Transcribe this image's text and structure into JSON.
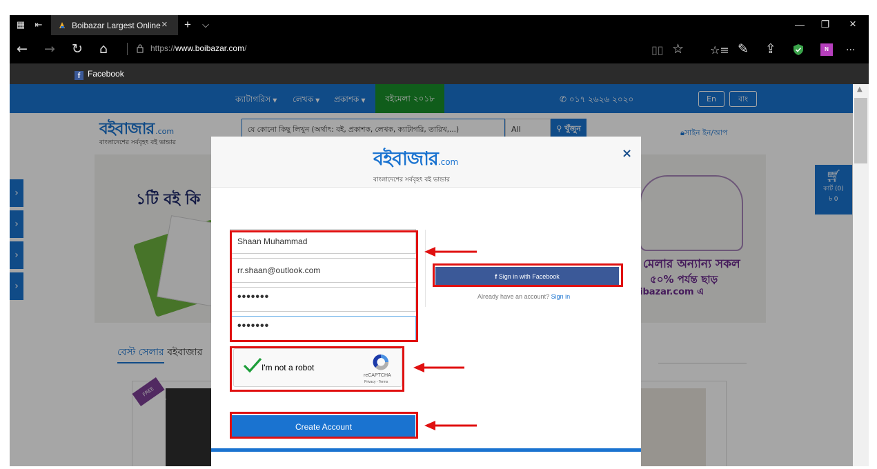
{
  "browser": {
    "tab_title": "Boibazar Largest Online",
    "tab_close": "×",
    "new_tab": "+",
    "tab_list": "⌵",
    "url_host": "https://",
    "url_domain": "www.boibazar.com",
    "url_path": "/",
    "favorites": [
      {
        "label": "Facebook"
      }
    ],
    "window_minimize": "—",
    "window_restore": "❐",
    "window_close": "×",
    "more": "···"
  },
  "site": {
    "menu": {
      "categories": "ক্যাটাগরিস",
      "authors": "লেখক",
      "publishers": "প্রকাশক",
      "book_fair": "বইমেলা ২০১৮",
      "phone": "০১৭ ২৬২৬ ২০২০",
      "lang_en": "En",
      "lang_bn": "বাং"
    },
    "logo": {
      "main": "বইবাজার",
      "com": ".com",
      "tagline": "বাংলাদেশের সর্ববৃহৎ বই ভান্ডার"
    },
    "search": {
      "placeholder": "যে কোনো কিছু লিখুন (অর্থাৎ: বই, প্রকাশক, লেখক, ক্যাটাগরি, তারিখ,...)",
      "select_value": "All",
      "button": "খুঁজুন"
    },
    "signin": "সাইন ইন/আপ",
    "banner": {
      "left_text": "১টি বই কি",
      "right_line1": "মেলার অন্যান্য সকল",
      "right_line2": "৫০% পর্যন্ত ছাড়",
      "right_line3": "ibazar.com এ"
    },
    "tabs": [
      {
        "label": "বেস্ট সেলার"
      },
      {
        "label": "বইবাজার"
      }
    ],
    "cart": {
      "label": "কার্ট (0)",
      "amount": "৳ 0"
    },
    "free_delivery": "FREE DELIVERY"
  },
  "modal": {
    "name_value": "Shaan Muhammad",
    "email_value": "rr.shaan@outlook.com",
    "password_value": "•••••••",
    "confirm_value": "•••••••",
    "facebook_button": "Sign in with Facebook",
    "already_text": "Already have an account?",
    "signin_link": "Sign in",
    "captcha_label": "I'm not a robot",
    "captcha_brand": "reCAPTCHA",
    "captcha_terms": "Privacy - Terms",
    "create_button": "Create Account",
    "close": "×"
  }
}
